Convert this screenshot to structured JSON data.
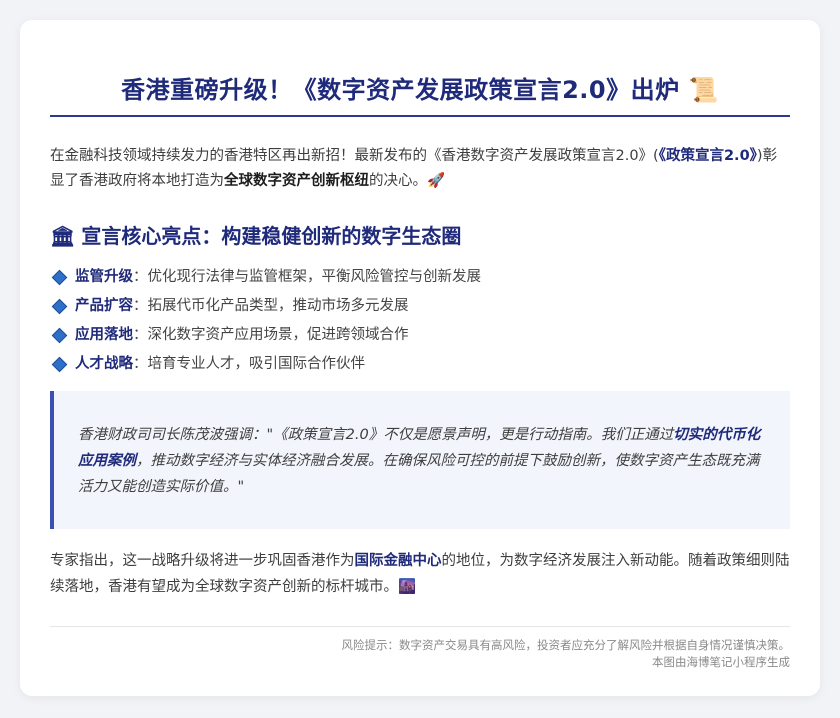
{
  "title": "香港重磅升级！《数字资产发展政策宣言2.0》出炉 📜",
  "intro": {
    "p1": "在金融科技领域持续发力的香港特区再出新招！最新发布的《香港数字资产发展政策宣言2.0》(",
    "p2": "《政策宣言2.0》",
    "p3": ")彰显了香港政府将本地打造为",
    "p4": "全球数字资产创新枢纽",
    "p5": "的决心。🚀"
  },
  "section": {
    "icon": "🏛",
    "heading": "宣言核心亮点：构建稳健创新的数字生态圈"
  },
  "highlights": [
    {
      "label": "监管升级",
      "text": "：优化现行法律与监管框架，平衡风险管控与创新发展"
    },
    {
      "label": "产品扩容",
      "text": "：拓展代币化产品类型，推动市场多元发展"
    },
    {
      "label": "应用落地",
      "text": "：深化数字资产应用场景，促进跨领域合作"
    },
    {
      "label": "人才战略",
      "text": "：培育专业人才，吸引国际合作伙伴"
    }
  ],
  "quote": {
    "q1": "香港财政司司长陈茂波强调：\"《政策宣言2.0》不仅是愿景声明，更是行动指南。我们正通过",
    "q2": "切实的代币化应用案例",
    "q3": "，推动数字经济与实体经济融合发展。在确保风险可控的前提下鼓励创新，使数字资产生态既充满活力又能创造实际价值。\""
  },
  "outro": {
    "o1": "专家指出，这一战略升级将进一步巩固香港作为",
    "o2": "国际金融中心",
    "o3": "的地位，为数字经济发展注入新动能。随着政策细则陆续落地，香港有望成为全球数字资产创新的标杆城市。🌆"
  },
  "footer": {
    "risk": "风险提示：数字资产交易具有高风险，投资者应充分了解风险并根据自身情况谨慎决策。",
    "generated": "本图由海博笔记小程序生成"
  },
  "colors": {
    "accent": "#1f2a7a",
    "quote_bar": "#3c4fb3",
    "quote_bg": "#f3f5fc",
    "bullet": "#2e6fc9"
  }
}
